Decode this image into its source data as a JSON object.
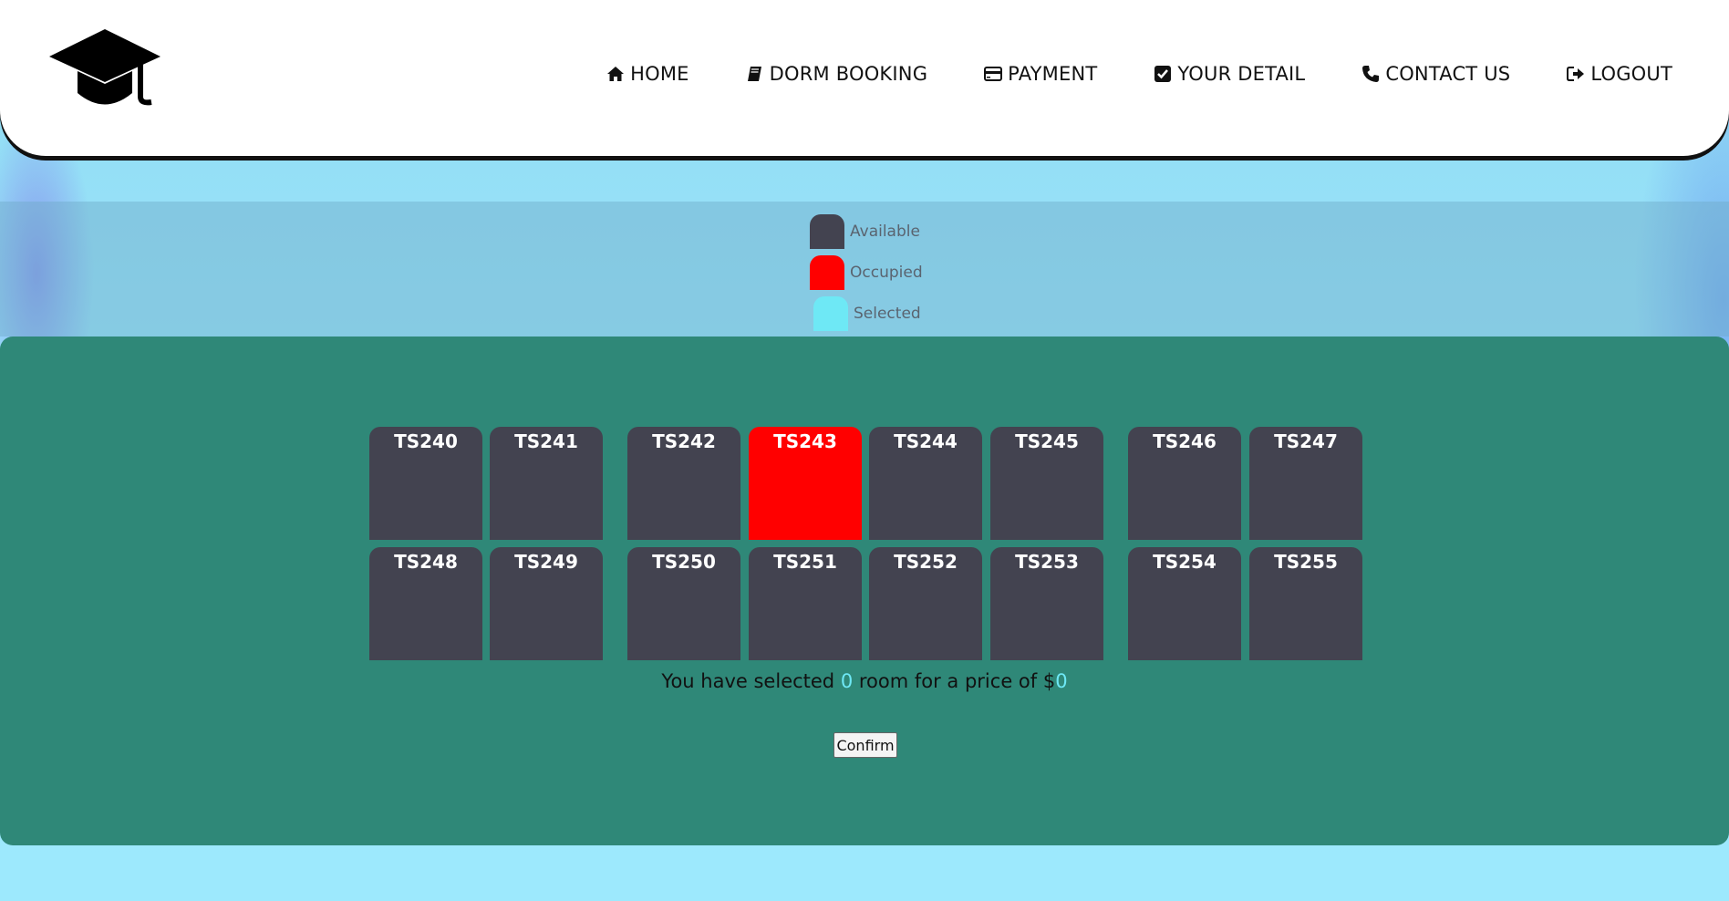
{
  "header": {
    "logo_icon": "graduation-cap-icon",
    "nav": [
      {
        "icon": "home-icon",
        "label": "HOME"
      },
      {
        "icon": "book-icon",
        "label": "DORM BOOKING"
      },
      {
        "icon": "credit-card-icon",
        "label": "PAYMENT"
      },
      {
        "icon": "check-square-icon",
        "label": "YOUR DETAIL"
      },
      {
        "icon": "phone-icon",
        "label": "CONTACT US"
      },
      {
        "icon": "sign-out-icon",
        "label": "LOGOUT"
      }
    ]
  },
  "legend": [
    {
      "label": "Available",
      "color": "#434350"
    },
    {
      "label": "Occupied",
      "color": "#ff0000"
    },
    {
      "label": "Selected",
      "color": "#6ee8f5"
    }
  ],
  "rooms": {
    "row1": [
      {
        "id": "TS240",
        "status": "available"
      },
      {
        "id": "TS241",
        "status": "available"
      },
      {
        "id": "TS242",
        "status": "available"
      },
      {
        "id": "TS243",
        "status": "occupied"
      },
      {
        "id": "TS244",
        "status": "available"
      },
      {
        "id": "TS245",
        "status": "available"
      },
      {
        "id": "TS246",
        "status": "available"
      },
      {
        "id": "TS247",
        "status": "available"
      }
    ],
    "row2": [
      {
        "id": "TS248",
        "status": "available"
      },
      {
        "id": "TS249",
        "status": "available"
      },
      {
        "id": "TS250",
        "status": "available"
      },
      {
        "id": "TS251",
        "status": "available"
      },
      {
        "id": "TS252",
        "status": "available"
      },
      {
        "id": "TS253",
        "status": "available"
      },
      {
        "id": "TS254",
        "status": "available"
      },
      {
        "id": "TS255",
        "status": "available"
      }
    ]
  },
  "summary": {
    "prefix": "You have selected ",
    "count": "0",
    "middle": " room for a price of $",
    "price": "0"
  },
  "confirm_label": "Confirm",
  "colors": {
    "panel": "#2f8878",
    "available": "#434350",
    "occupied": "#ff0000",
    "selected": "#6ee8f5"
  }
}
